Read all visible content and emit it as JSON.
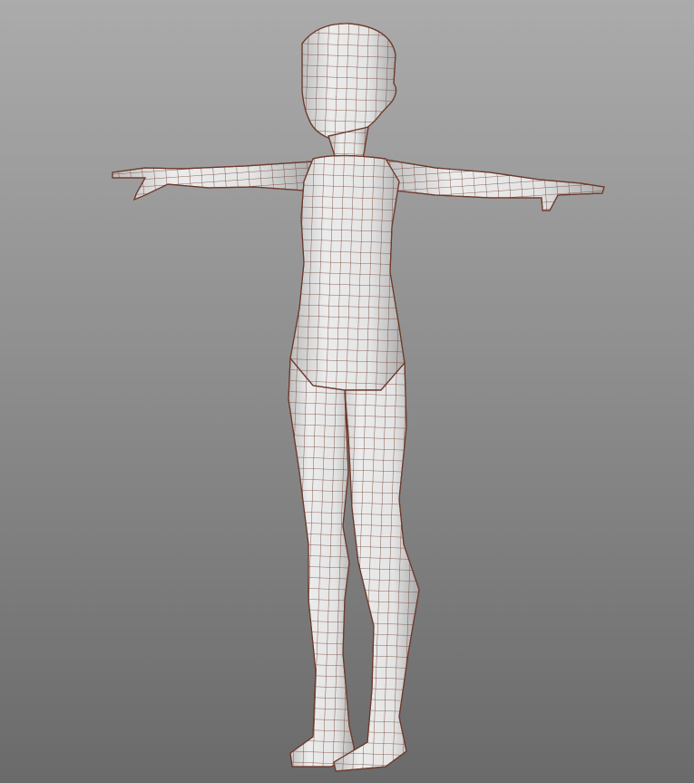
{
  "viewport": {
    "subject": "character-base-mesh",
    "colors": {
      "background_top": "#ababab",
      "background_bottom": "#6a6a6a",
      "mesh_fill": "#e4e4e4",
      "mesh_shade": "#b9b9b9",
      "wire": "#6e3a2c"
    }
  }
}
